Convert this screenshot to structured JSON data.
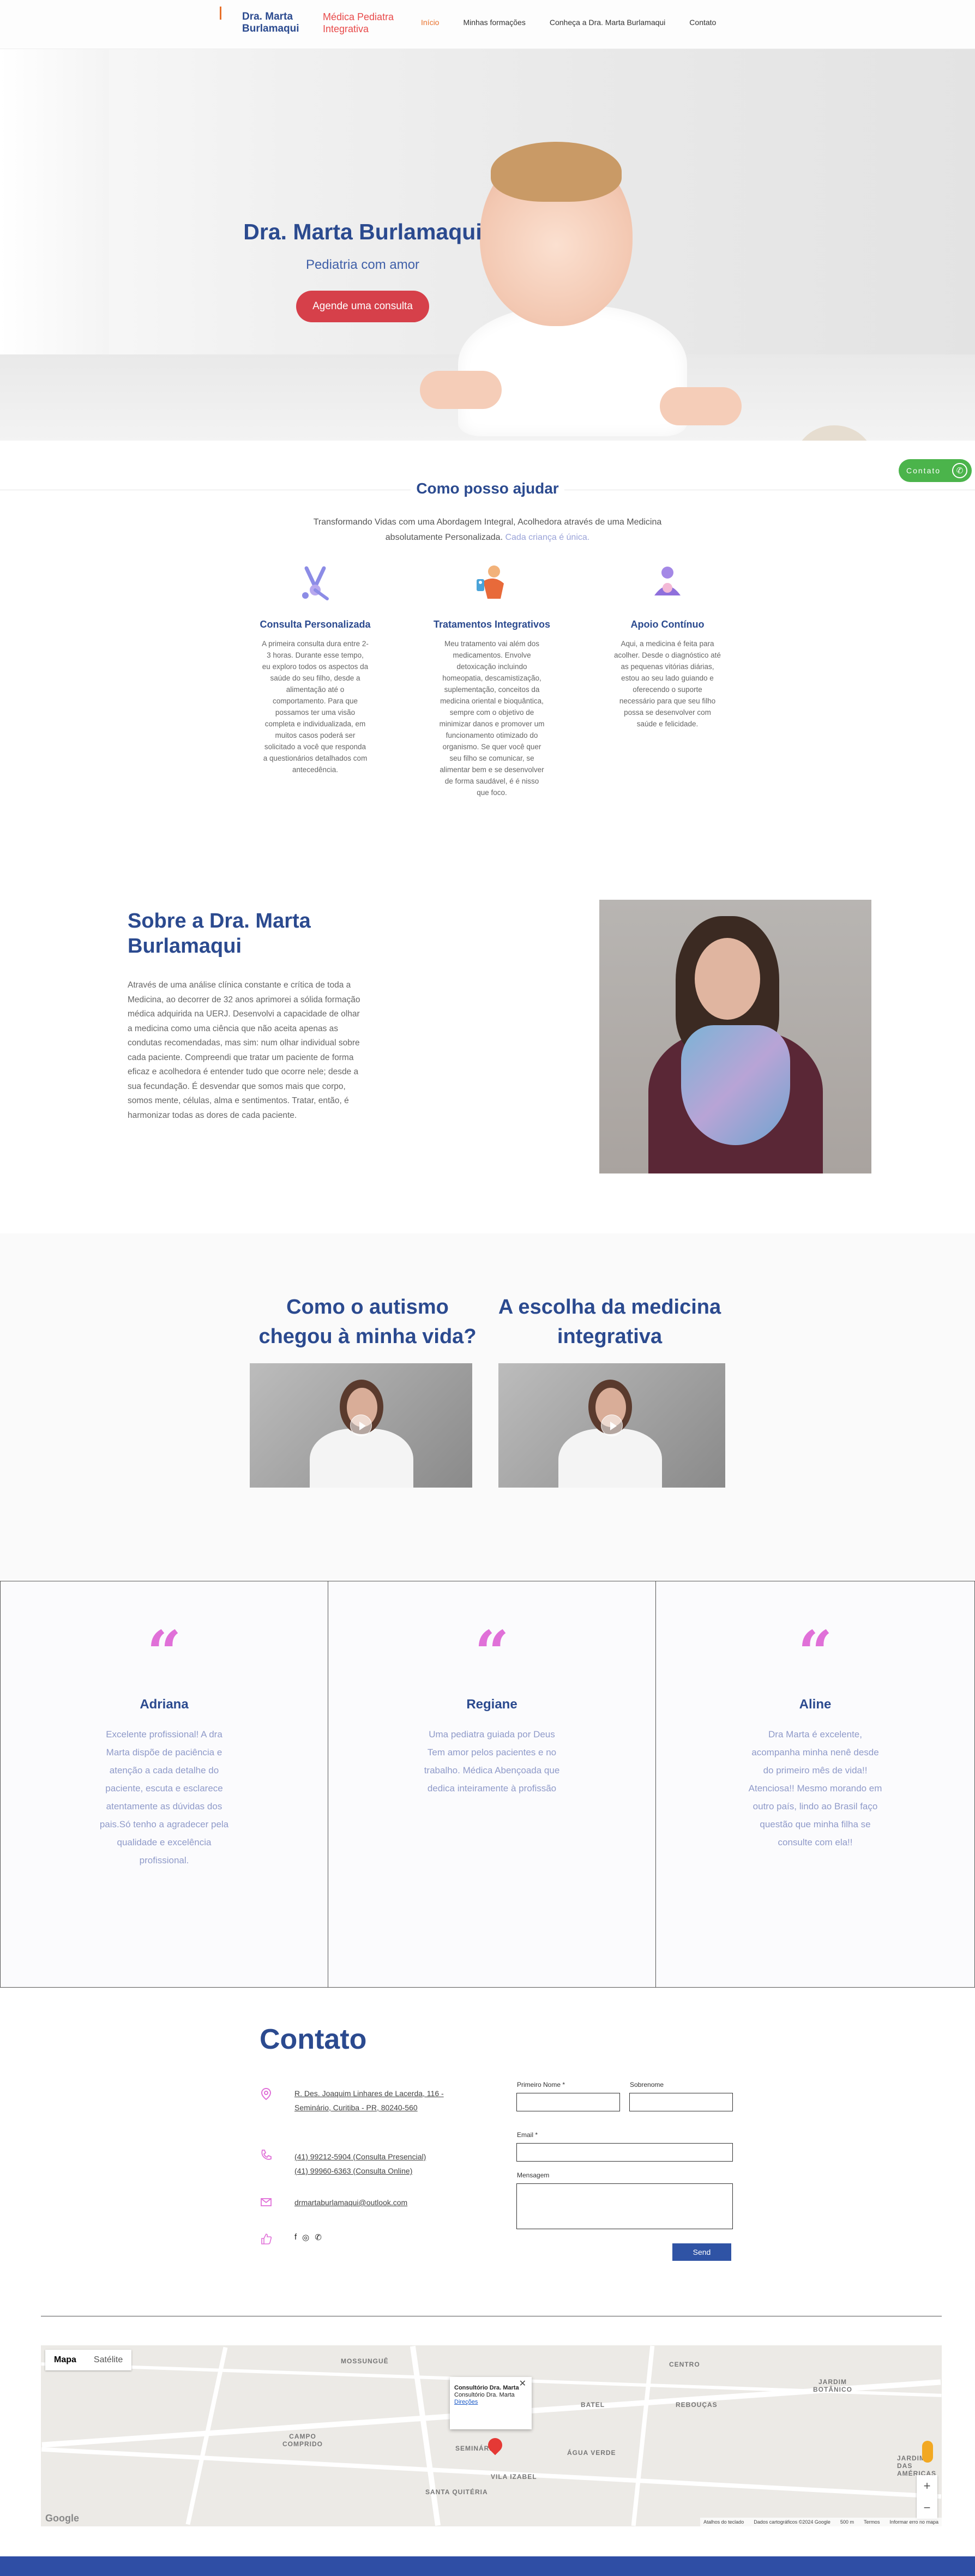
{
  "header": {
    "brand_name": "Dra. Marta Burlamaqui",
    "brand_tagline": "Médica Pediatra Integrativa",
    "nav": [
      "Início",
      "Minhas formações",
      "Conheça a Dra. Marta Burlamaqui",
      "Contato"
    ]
  },
  "hero": {
    "title": "Dra. Marta Burlamaqui",
    "subtitle": "Pediatria com amor",
    "cta": "Agende uma consulta"
  },
  "whatsapp": {
    "label": "Contato"
  },
  "help": {
    "title": "Como posso ajudar",
    "intro": "Transformando Vidas com uma Abordagem Integral, Acolhedora através de uma Medicina absolutamente Personalizada.",
    "intro_highlight": "Cada criança é única.",
    "cards": [
      {
        "title": "Consulta Personalizada",
        "text": "A primeira consulta dura entre 2-3 horas. Durante esse tempo, eu exploro todos os aspectos da saúde do seu filho, desde a alimentação até o comportamento. Para que possamos ter uma visão completa e individualizada, em muitos casos poderá ser solicitado a você que responda a questionários detalhados com antecedência."
      },
      {
        "title": "Tratamentos Integrativos",
        "text": "Meu tratamento vai além dos medicamentos. Envolve detoxicação incluindo homeopatia, descamistização, suplementação, conceitos da medicina oriental e bioquântica, sempre com o objetivo de minimizar danos e promover um funcionamento otimizado do organismo. Se quer você quer seu filho se comunicar, se alimentar bem e se desenvolver de forma saudável, é é nisso que foco."
      },
      {
        "title": "Apoio Contínuo",
        "text": "Aqui, a medicina é feita para acolher. Desde o diagnóstico até as pequenas vitórias diárias, estou ao seu lado guiando e oferecendo o suporte necessário para que seu filho possa se desenvolver com saúde e felicidade."
      }
    ]
  },
  "about": {
    "title": "Sobre a Dra. Marta Burlamaqui",
    "text": "Através de uma análise clínica constante e crítica de toda a Medicina, ao decorrer de 32 anos aprimorei a sólida formação médica adquirida na UERJ. Desenvolvi a capacidade de olhar a medicina como uma ciência que não aceita apenas as condutas recomendadas, mas sim: num olhar individual sobre cada paciente. Compreendi que tratar um paciente de forma eficaz e acolhedora é entender tudo que ocorre nele; desde a sua fecundação. É desvendar que somos mais que corpo, somos mente, células, alma e sentimentos. Tratar, então, é harmonizar todas as dores de cada paciente."
  },
  "videos": [
    {
      "title": "Como o autismo chegou à minha vida?"
    },
    {
      "title": "A escolha da medicina integrativa"
    }
  ],
  "testimonials": [
    {
      "name": "Adriana",
      "text": "Excelente profissional! A dra Marta dispõe de paciência e atenção a cada detalhe do paciente, escuta e esclarece atentamente as dúvidas dos pais.Só tenho a agradecer pela qualidade e excelência profissional."
    },
    {
      "name": "Regiane",
      "text": "Uma pediatra guiada por Deus Tem amor pelos pacientes e no trabalho. Médica Abençoada que dedica inteiramente à profissão"
    },
    {
      "name": "Aline",
      "text": "Dra Marta é excelente, acompanha minha nenê desde do primeiro mês de vida!! Atenciosa!! Mesmo morando em outro país, lindo ao Brasil faço questão que minha filha se consulte com ela!!"
    }
  ],
  "contact": {
    "title": "Contato",
    "address_1": "R. Des. Joaquim Linhares de Lacerda, 116 -",
    "address_2": "Seminário, Curitiba - PR, 80240-560",
    "phone_1": "(41) 99212-5904 (Consulta Presencial)",
    "phone_2": "(41) 99960-6363 (Consulta Online)",
    "email": "drmartaburlamaqui@outlook.com",
    "form": {
      "first_name": "Primeiro Nome *",
      "last_name": "Sobrenome",
      "email": "Email *",
      "message": "Mensagem",
      "send": "Send"
    }
  },
  "map": {
    "tab_map": "Mapa",
    "tab_satellite": "Satélite",
    "popup_title": "Consultório Dra. Marta",
    "popup_sub": "Consultório Dra. Marta",
    "popup_link": "Direções",
    "labels": [
      "MOSSUNGUÊ",
      "CENTRO",
      "JARDIM BOTÂNICO",
      "BATEL",
      "REBOUÇAS",
      "CAMPO COMPRIDO",
      "SEMINÁRIO",
      "ÁGUA VERDE",
      "VILA IZABEL",
      "SANTA QUITÉRIA",
      "JARDIM DAS AMÉRICAS"
    ],
    "footer": [
      "Atalhos do teclado",
      "Dados cartográficos ©2024 Google",
      "500 m",
      "Termos",
      "Informar erro no mapa"
    ],
    "google": "Google"
  }
}
